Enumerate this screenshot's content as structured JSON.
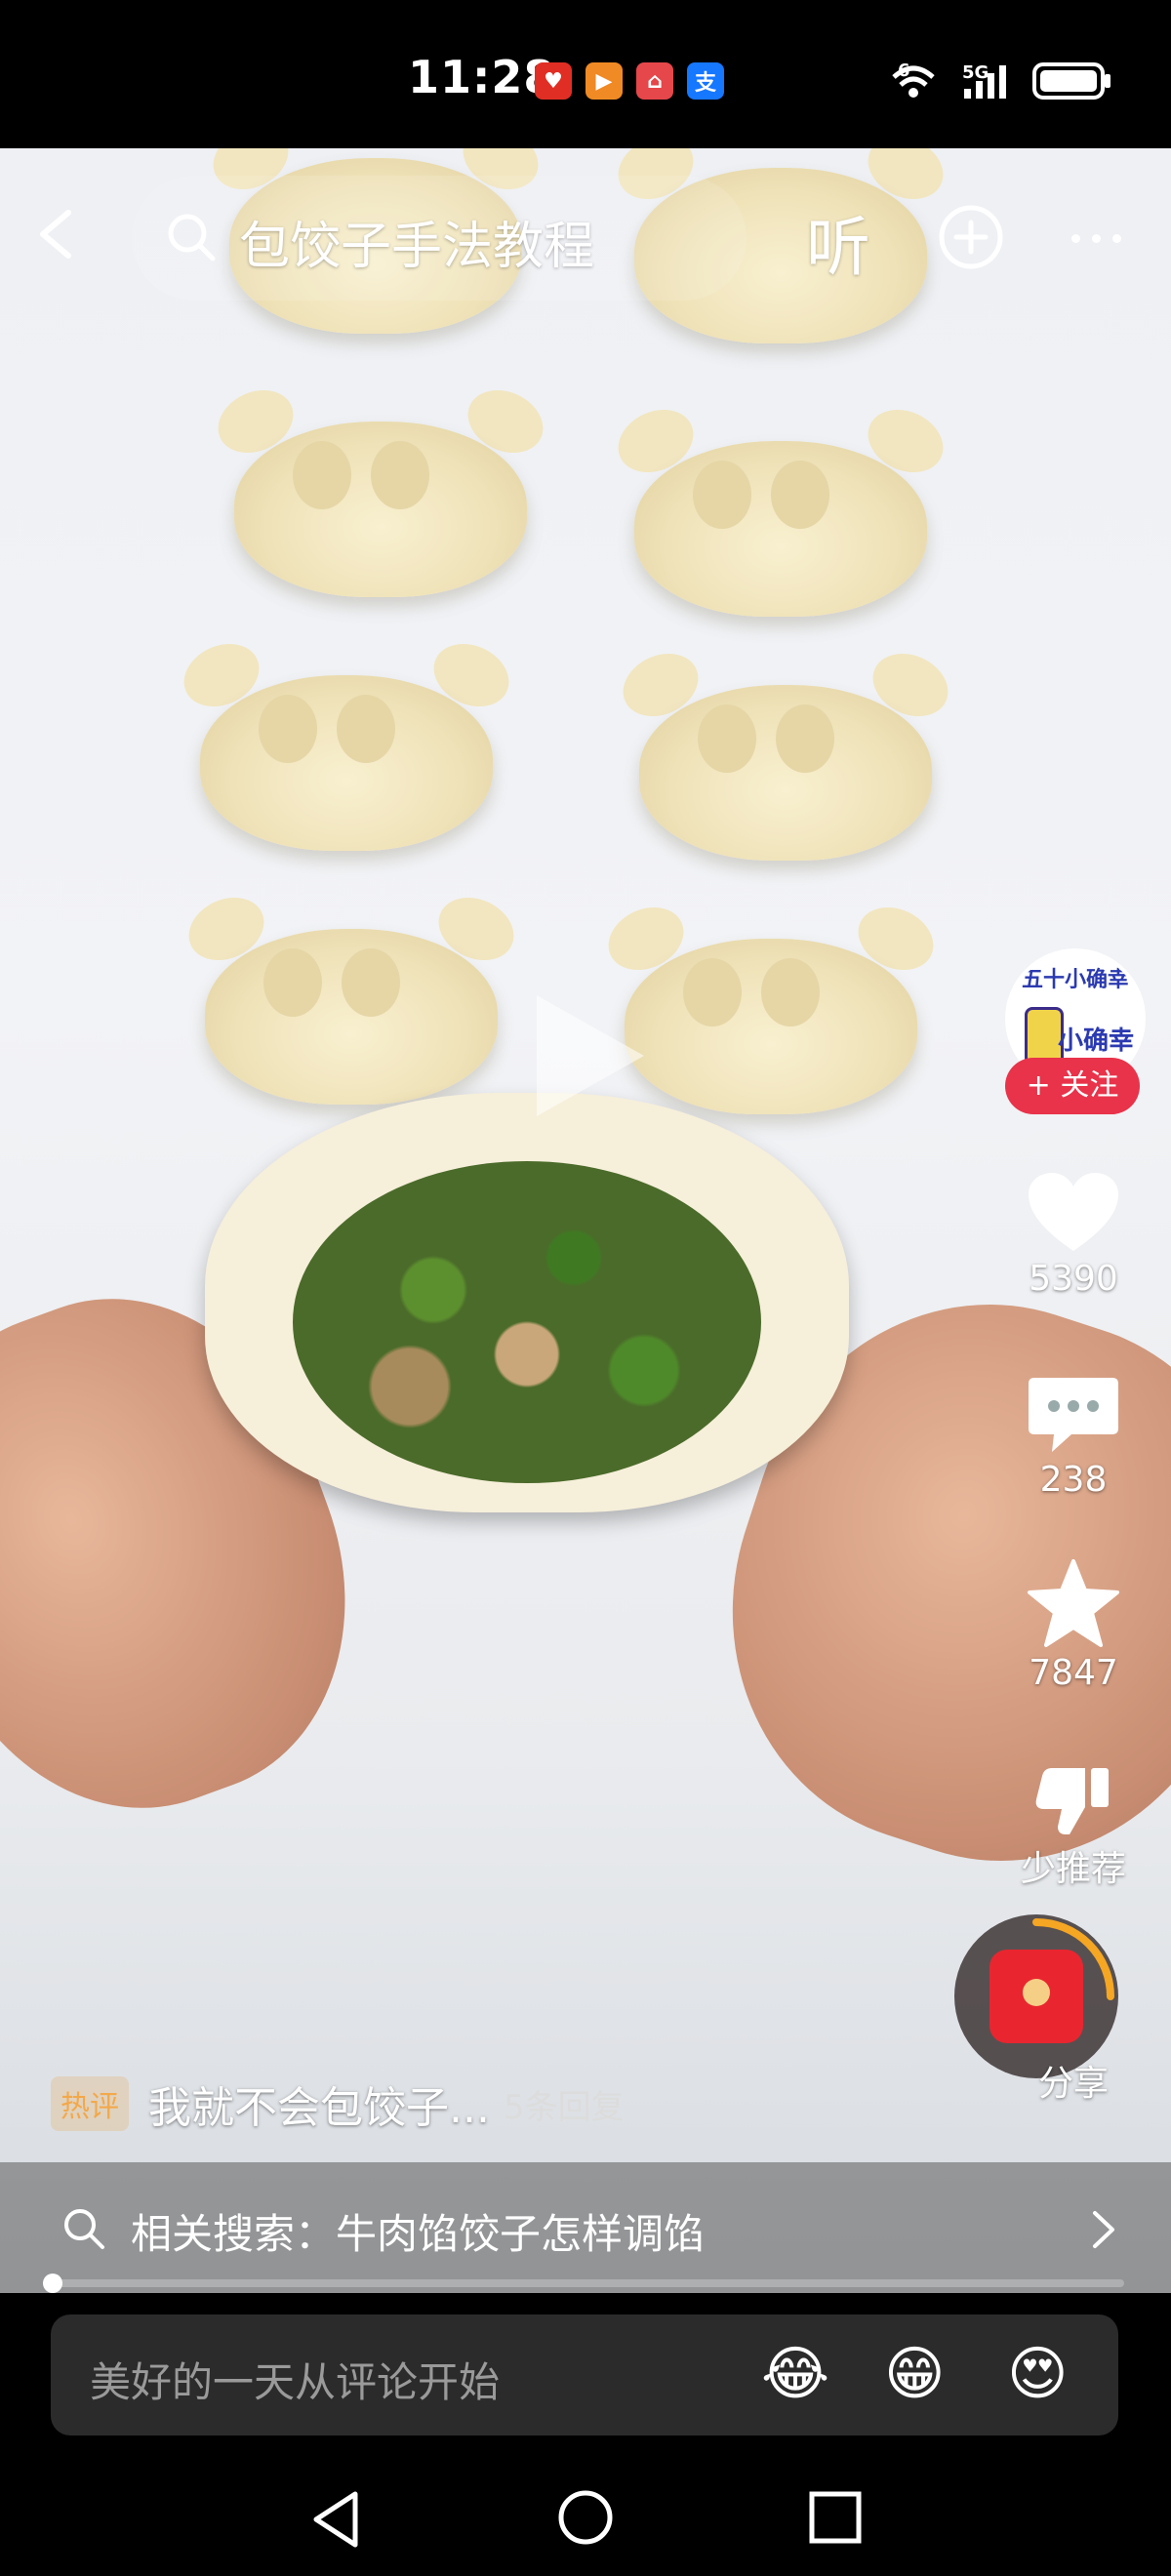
{
  "status_bar": {
    "time": "11:28",
    "app_icons": [
      "pinduoduo-icon",
      "bilibili-icon",
      "taobao-icon",
      "alipay-icon"
    ],
    "signal_label": "6",
    "network_label": "5G"
  },
  "top_bar": {
    "search_query": "包饺子手法教程",
    "listen_label": "听"
  },
  "creator": {
    "avatar_line1": "五十小确幸",
    "avatar_line2": "小确幸",
    "follow_label": "+ 关注"
  },
  "actions": {
    "likes": "5390",
    "comments": "238",
    "favorites": "7847",
    "dislike_label": "少推荐",
    "share_label": "分享"
  },
  "hot_comment": {
    "tag": "热评",
    "text": "我就不会包饺子...",
    "replies": "5条回复"
  },
  "related_search": {
    "text": "相关搜索：牛肉馅饺子怎样调馅"
  },
  "playback": {
    "progress": 0
  },
  "comment_input": {
    "placeholder": "美好的一天从评论开始",
    "emojis": [
      "😂",
      "😁",
      "😍"
    ]
  },
  "colors": {
    "follow_red": "#e8334a",
    "hot_tag": "#f3a84a",
    "redpacket": "#e9262f"
  }
}
